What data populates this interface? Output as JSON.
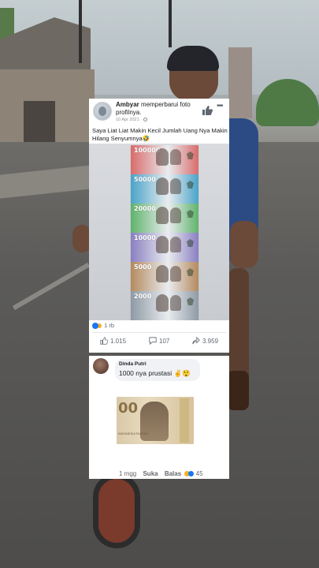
{
  "post": {
    "author": "Ambyar",
    "action_text": "memperbarui foto profilnya.",
    "time": "10 Apr 2021",
    "caption": "Saya Liat Liat Makin Kecil Jumlah Uang Nya Makin Hilang Senyumnya🤣",
    "more_label": "•••",
    "bills": [
      {
        "label": "100000",
        "color": "#d96b6b"
      },
      {
        "label": "50000",
        "color": "#4aa3c9"
      },
      {
        "label": "20000",
        "color": "#5fb36b"
      },
      {
        "label": "10000",
        "color": "#8a7fc2"
      },
      {
        "label": "5000",
        "color": "#b58a5e"
      },
      {
        "label": "2000",
        "color": "#8f9aa6"
      }
    ],
    "reaction_count": "1 rb",
    "likes": "1.015",
    "comments": "107",
    "shares": "3.959"
  },
  "comment": {
    "name": "Dinda Putri",
    "text": "1000 nya prustasi ✌️😲",
    "image_number": "00",
    "image_caption": "INDONESIA RUPIAH",
    "time": "1 mgg",
    "like_label": "Suka",
    "reply_label": "Balas",
    "reaction_count": "45"
  },
  "colors": {
    "facebook_blue": "#1877f2",
    "text_dark": "#1c1e21",
    "text_muted": "#65676b"
  }
}
